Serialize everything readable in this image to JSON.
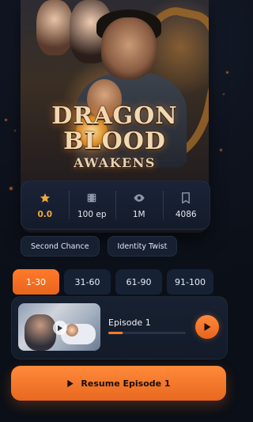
{
  "poster": {
    "title_line1": "DRAGON",
    "title_line2": "BLOOD",
    "title_line3": "AWAKENS"
  },
  "stats": [
    {
      "icon": "star-icon",
      "value": "0.0",
      "color": "#f4a93a"
    },
    {
      "icon": "film-icon",
      "value": "100 ep"
    },
    {
      "icon": "eye-icon",
      "value": "1M"
    },
    {
      "icon": "bookmark-icon",
      "value": "4086"
    }
  ],
  "tags": [
    "Second Chance",
    "Identity Twist"
  ],
  "ranges": [
    {
      "label": "1-30",
      "active": true
    },
    {
      "label": "31-60",
      "active": false
    },
    {
      "label": "61-90",
      "active": false
    },
    {
      "label": "91-100",
      "active": false
    }
  ],
  "current_episode": {
    "title": "Episode 1",
    "progress": 0.18
  },
  "resume_button": {
    "label": "Resume Episode 1"
  },
  "colors": {
    "accent": "#ff7a2a",
    "background": "#0f1420",
    "card": "#162134"
  }
}
